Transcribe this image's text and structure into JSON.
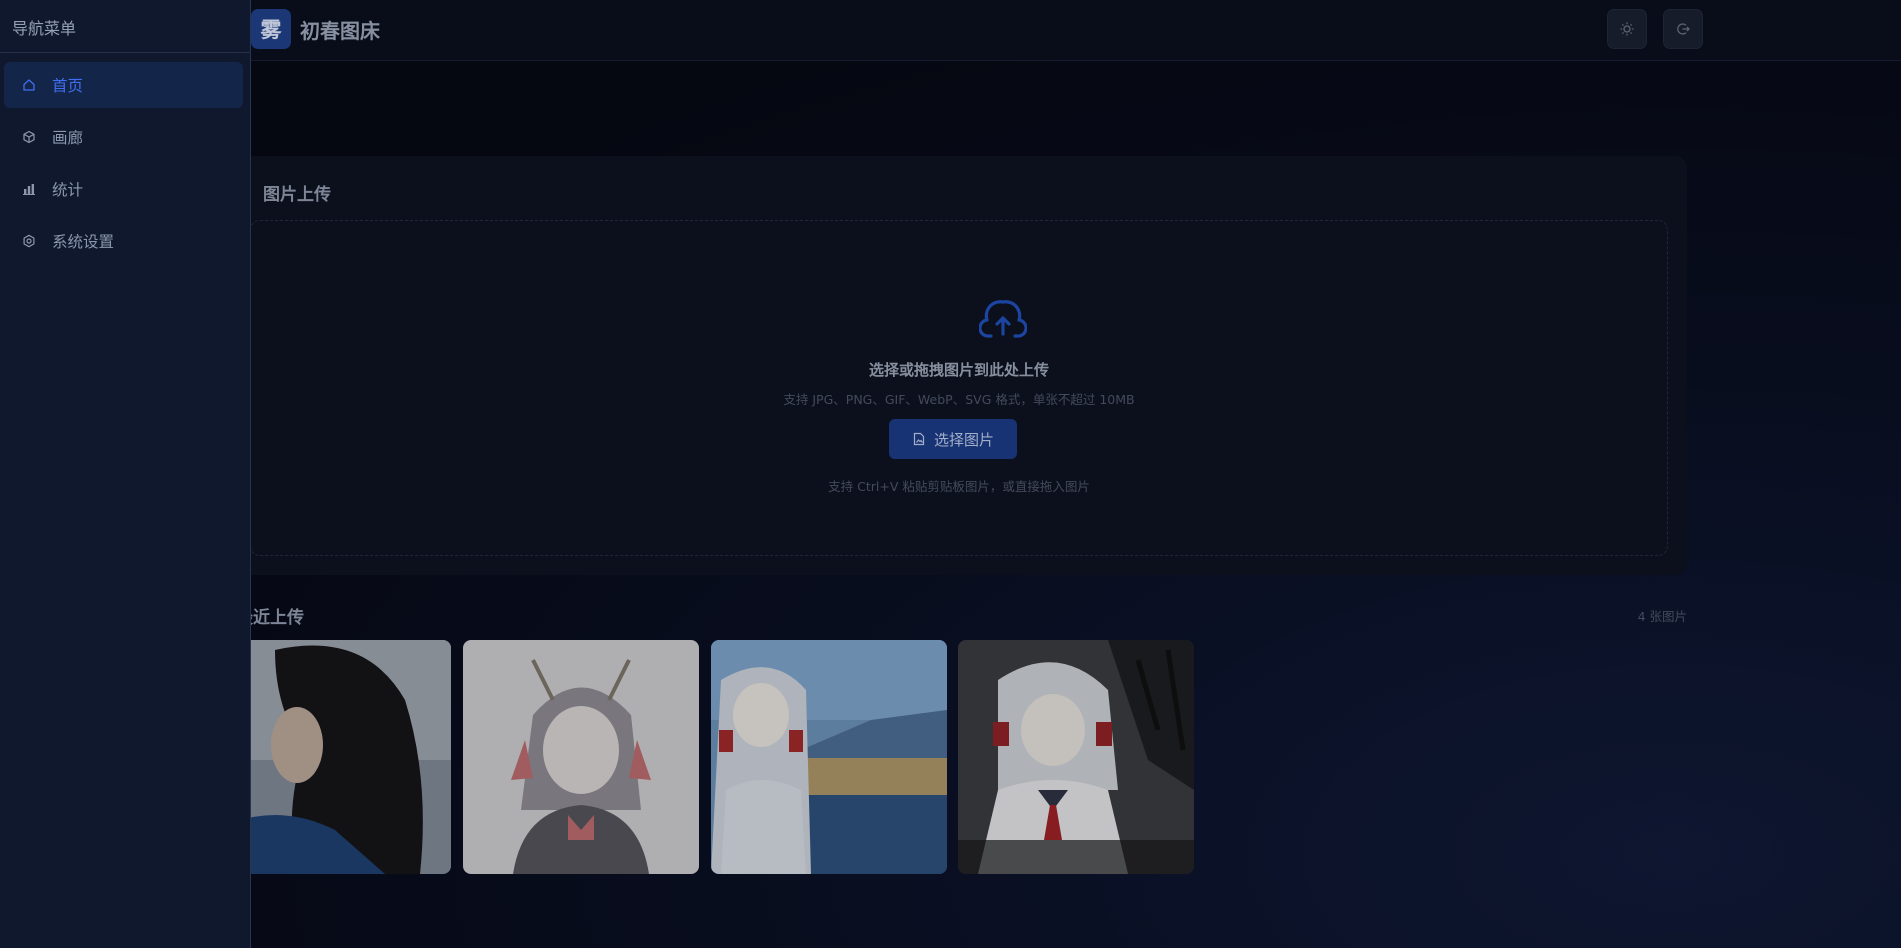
{
  "header": {
    "logo_char": "雾",
    "app_title": "初春图床",
    "theme_button_icon": "sun-icon",
    "logout_button_icon": "logout-icon"
  },
  "upload": {
    "title": "图片上传",
    "dropzone_title": "选择或拖拽图片到此处上传",
    "formats": "支持 JPG、PNG、GIF、WebP、SVG 格式，单张不超过 10MB",
    "choose_button": "选择图片",
    "paste_hint": "支持 Ctrl+V 粘贴剪贴板图片，或直接拖入图片"
  },
  "recent": {
    "title": "最近上传",
    "count": "4 张图片",
    "thumbnails": [
      {
        "subject": "photo-woman-dark-hair"
      },
      {
        "subject": "sketch-anime-girl-antlers"
      },
      {
        "subject": "anime-girl-lakeside"
      },
      {
        "subject": "anime-girl-ruins"
      }
    ]
  },
  "sidebar": {
    "title": "导航菜单",
    "items": [
      {
        "label": "首页",
        "icon": "home-icon",
        "active": true
      },
      {
        "label": "画廊",
        "icon": "gallery-icon",
        "active": false
      },
      {
        "label": "统计",
        "icon": "chart-icon",
        "active": false
      },
      {
        "label": "系统设置",
        "icon": "settings-icon",
        "active": false
      }
    ]
  },
  "colors": {
    "accent": "#3f6ff0",
    "button": "#1c3b83",
    "background": "#070a16",
    "sidebar": "#0f182d"
  }
}
